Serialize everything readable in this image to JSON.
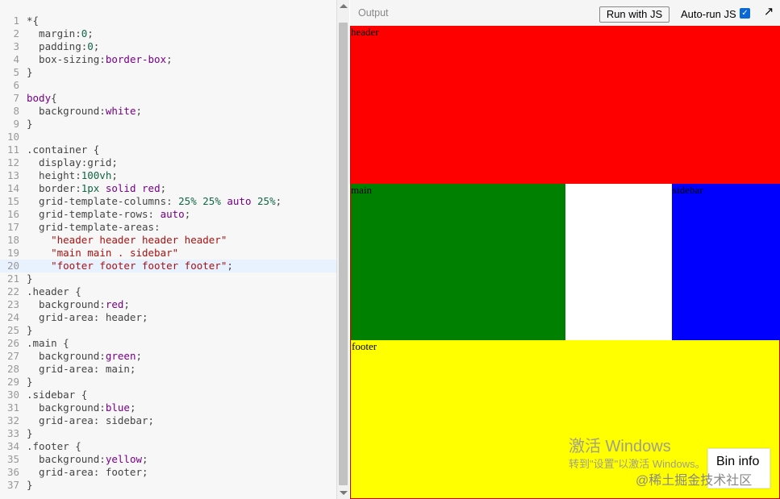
{
  "editor": {
    "lines": [
      {
        "n": "1",
        "t": [
          [
            "*{",
            "sel"
          ]
        ]
      },
      {
        "n": "2",
        "t": [
          [
            "  margin:",
            "att"
          ],
          [
            "0",
            "num"
          ],
          [
            ";",
            "att"
          ]
        ]
      },
      {
        "n": "3",
        "t": [
          [
            "  padding:",
            "att"
          ],
          [
            "0",
            "num"
          ],
          [
            ";",
            "att"
          ]
        ]
      },
      {
        "n": "4",
        "t": [
          [
            "  box-sizing:",
            "att"
          ],
          [
            "border-box",
            "tag"
          ],
          [
            ";",
            "att"
          ]
        ]
      },
      {
        "n": "5",
        "t": [
          [
            "}",
            "sel"
          ]
        ]
      },
      {
        "n": "6",
        "t": [
          [
            "",
            "sel"
          ]
        ]
      },
      {
        "n": "7",
        "t": [
          [
            "body",
            "tag"
          ],
          [
            "{",
            "sel"
          ]
        ]
      },
      {
        "n": "8",
        "t": [
          [
            "  background:",
            "att"
          ],
          [
            "white",
            "tag"
          ],
          [
            ";",
            "att"
          ]
        ]
      },
      {
        "n": "9",
        "t": [
          [
            "}",
            "sel"
          ]
        ]
      },
      {
        "n": "10",
        "t": [
          [
            "",
            "sel"
          ]
        ]
      },
      {
        "n": "11",
        "t": [
          [
            ".container {",
            "sel"
          ]
        ]
      },
      {
        "n": "12",
        "t": [
          [
            "  display:grid;",
            "att"
          ]
        ]
      },
      {
        "n": "13",
        "t": [
          [
            "  height:",
            "att"
          ],
          [
            "100vh",
            "num"
          ],
          [
            ";",
            "att"
          ]
        ]
      },
      {
        "n": "14",
        "t": [
          [
            "  border:",
            "att"
          ],
          [
            "1px",
            "num"
          ],
          [
            " ",
            "att"
          ],
          [
            "solid",
            "tag"
          ],
          [
            " ",
            "att"
          ],
          [
            "red",
            "tag"
          ],
          [
            ";",
            "att"
          ]
        ]
      },
      {
        "n": "15",
        "t": [
          [
            "  grid-template-columns: ",
            "att"
          ],
          [
            "25%",
            "num"
          ],
          [
            " ",
            "att"
          ],
          [
            "25%",
            "num"
          ],
          [
            " ",
            "att"
          ],
          [
            "auto",
            "tag"
          ],
          [
            " ",
            "att"
          ],
          [
            "25%",
            "num"
          ],
          [
            ";",
            "att"
          ]
        ]
      },
      {
        "n": "16",
        "t": [
          [
            "  grid-template-rows: ",
            "att"
          ],
          [
            "auto",
            "tag"
          ],
          [
            ";",
            "att"
          ]
        ]
      },
      {
        "n": "17",
        "t": [
          [
            "  grid-template-areas:",
            "att"
          ]
        ]
      },
      {
        "n": "18",
        "t": [
          [
            "    ",
            "att"
          ],
          [
            "\"header header header header\"",
            "str"
          ]
        ]
      },
      {
        "n": "19",
        "t": [
          [
            "    ",
            "att"
          ],
          [
            "\"main main . sidebar\"",
            "str"
          ]
        ]
      },
      {
        "n": "20",
        "t": [
          [
            "    ",
            "att"
          ],
          [
            "\"footer footer footer footer\"",
            "str"
          ],
          [
            ";",
            "att"
          ]
        ]
      },
      {
        "n": "21",
        "t": [
          [
            "}",
            "sel"
          ]
        ]
      },
      {
        "n": "22",
        "t": [
          [
            ".header {",
            "sel"
          ]
        ]
      },
      {
        "n": "23",
        "t": [
          [
            "  background:",
            "att"
          ],
          [
            "red",
            "tag"
          ],
          [
            ";",
            "att"
          ]
        ]
      },
      {
        "n": "24",
        "t": [
          [
            "  grid-area: header;",
            "att"
          ]
        ]
      },
      {
        "n": "25",
        "t": [
          [
            "}",
            "sel"
          ]
        ]
      },
      {
        "n": "26",
        "t": [
          [
            ".main {",
            "sel"
          ]
        ]
      },
      {
        "n": "27",
        "t": [
          [
            "  background:",
            "att"
          ],
          [
            "green",
            "tag"
          ],
          [
            ";",
            "att"
          ]
        ]
      },
      {
        "n": "28",
        "t": [
          [
            "  grid-area: main;",
            "att"
          ]
        ]
      },
      {
        "n": "29",
        "t": [
          [
            "}",
            "sel"
          ]
        ]
      },
      {
        "n": "30",
        "t": [
          [
            ".sidebar {",
            "sel"
          ]
        ]
      },
      {
        "n": "31",
        "t": [
          [
            "  background:",
            "att"
          ],
          [
            "blue",
            "tag"
          ],
          [
            ";",
            "att"
          ]
        ]
      },
      {
        "n": "32",
        "t": [
          [
            "  grid-area: sidebar;",
            "att"
          ]
        ]
      },
      {
        "n": "33",
        "t": [
          [
            "}",
            "sel"
          ]
        ]
      },
      {
        "n": "34",
        "t": [
          [
            ".footer {",
            "sel"
          ]
        ]
      },
      {
        "n": "35",
        "t": [
          [
            "  background:",
            "att"
          ],
          [
            "yellow",
            "tag"
          ],
          [
            ";",
            "att"
          ]
        ]
      },
      {
        "n": "36",
        "t": [
          [
            "  grid-area: footer;",
            "att"
          ]
        ]
      },
      {
        "n": "37",
        "t": [
          [
            "}",
            "sel"
          ]
        ]
      }
    ],
    "active_line": "20"
  },
  "toolbar": {
    "output_label": "Output",
    "run_button": "Run with JS",
    "autorun_label": "Auto-run JS",
    "autorun_checked": true,
    "popout_icon": "arrow-up-right-icon"
  },
  "preview": {
    "header": {
      "label": "header",
      "color": "#ff0000"
    },
    "main": {
      "label": "main",
      "color": "#008000"
    },
    "sidebar": {
      "label": "sidebar",
      "color": "#0000ff"
    },
    "footer": {
      "label": "footer",
      "color": "#ffff00"
    },
    "gap_color": "#ffffff"
  },
  "overlay": {
    "watermark_title": "激活 Windows",
    "watermark_sub": "转到\"设置\"以激活 Windows。",
    "bin_info": "Bin info",
    "credit": "@稀土掘金技术社区"
  }
}
